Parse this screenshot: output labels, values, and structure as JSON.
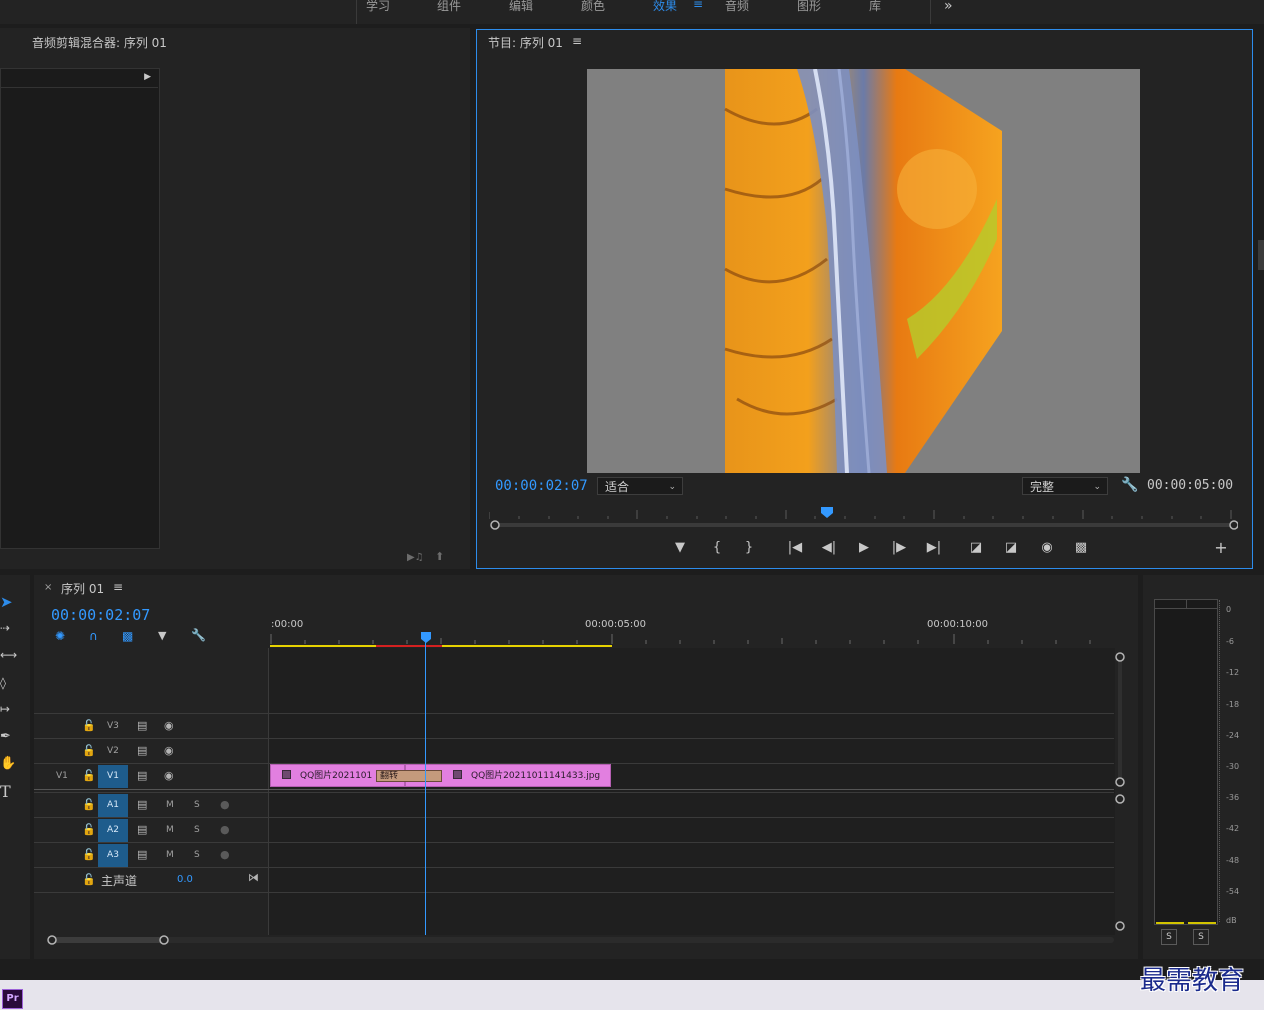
{
  "workspaces": [
    {
      "label": "学习"
    },
    {
      "label": "组件"
    },
    {
      "label": "编辑"
    },
    {
      "label": "颜色"
    },
    {
      "label": "效果"
    },
    {
      "label": "音频"
    },
    {
      "label": "图形"
    },
    {
      "label": "库"
    }
  ],
  "workspace_active": "效果",
  "workspace_more": "»",
  "menu_glyph": "≡",
  "audio_mixer": {
    "title": "音频剪辑混合器: 序列 01"
  },
  "program": {
    "title": "节目: 序列 01",
    "current_time": "00:00:02:07",
    "fit_label": "适合",
    "quality_label": "完整",
    "duration": "00:00:05:00",
    "playhead_fraction": 0.45
  },
  "timeline": {
    "close_label": "×",
    "title": "序列 01",
    "current_time": "00:00:02:07",
    "ruler": {
      "start": ":00:00",
      "mid": "00:00:05:00",
      "end": "00:00:10:00"
    },
    "playhead_seconds": 2.28,
    "tracks_video": [
      {
        "label": "V3"
      },
      {
        "label": "V2"
      },
      {
        "source": "V1",
        "label": "V1"
      }
    ],
    "tracks_audio": [
      {
        "label": "A1",
        "m": "M",
        "s": "S"
      },
      {
        "label": "A2",
        "m": "M",
        "s": "S"
      },
      {
        "label": "A3",
        "m": "M",
        "s": "S"
      }
    ],
    "master": {
      "label": "主声道",
      "value": "0.0"
    },
    "clips": [
      {
        "name": "QQ图片2021101"
      },
      {
        "name": "翻转"
      },
      {
        "name": "QQ图片20211011141433.jpg"
      }
    ]
  },
  "meter": {
    "scale": [
      "0",
      "-6",
      "-12",
      "-18",
      "-24",
      "-30",
      "-36",
      "-42",
      "-48",
      "-54",
      "dB"
    ],
    "solo": [
      "S",
      "S"
    ]
  },
  "app_badge": "Pr",
  "watermark": "最需教育",
  "colors": {
    "accent": "#2d8ceb",
    "clip": "#e27fe0",
    "playhead": "#3399ff"
  }
}
